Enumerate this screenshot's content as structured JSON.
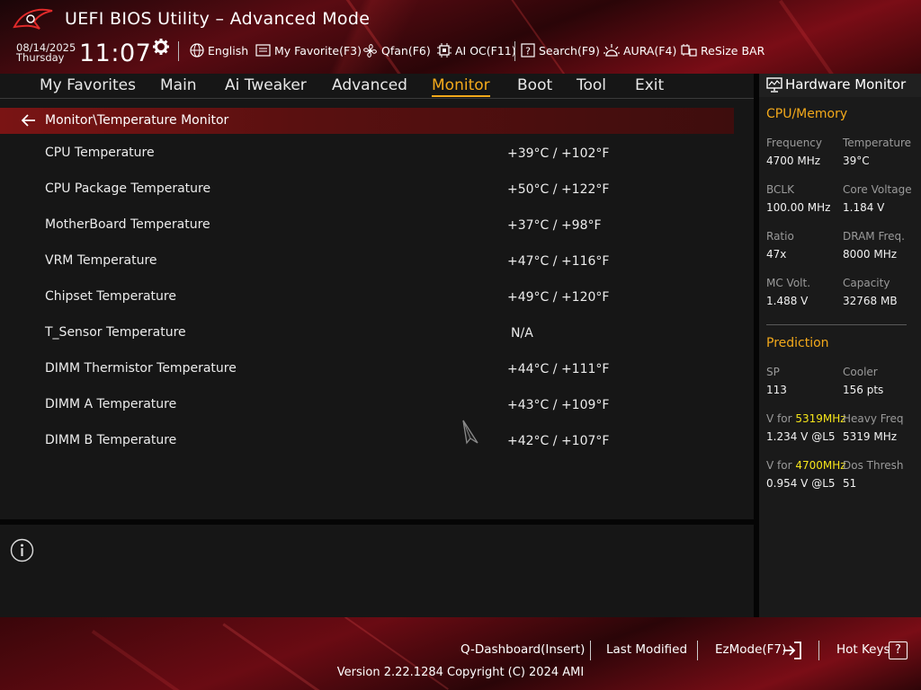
{
  "header": {
    "title": "UEFI BIOS Utility – Advanced Mode",
    "date": "08/14/2025",
    "day": "Thursday",
    "time": "11:07",
    "tools": [
      {
        "label": "English",
        "icon": "globe-icon"
      },
      {
        "label": "My Favorite(F3)",
        "icon": "favorite-icon"
      },
      {
        "label": "Qfan(F6)",
        "icon": "fan-icon"
      },
      {
        "label": "AI OC(F11)",
        "icon": "ai-chip-icon"
      },
      {
        "label": "Search(F9)",
        "icon": "search-icon"
      },
      {
        "label": "AURA(F4)",
        "icon": "aura-icon"
      },
      {
        "label": "ReSize BAR",
        "icon": "resize-bar-icon"
      }
    ]
  },
  "nav": {
    "tabs": [
      "My Favorites",
      "Main",
      "Ai Tweaker",
      "Advanced",
      "Monitor",
      "Boot",
      "Tool",
      "Exit"
    ],
    "active": "Monitor"
  },
  "breadcrumb": "Monitor\\Temperature Monitor",
  "temperatures": [
    {
      "label": "CPU Temperature",
      "value": "+39°C / +102°F"
    },
    {
      "label": "CPU Package Temperature",
      "value": "+50°C / +122°F"
    },
    {
      "label": "MotherBoard Temperature",
      "value": "+37°C / +98°F"
    },
    {
      "label": "VRM Temperature",
      "value": "+47°C / +116°F"
    },
    {
      "label": "Chipset Temperature",
      "value": "+49°C / +120°F"
    },
    {
      "label": "T_Sensor Temperature",
      "value": " N/A"
    },
    {
      "label": "DIMM Thermistor Temperature",
      "value": "+44°C / +111°F"
    },
    {
      "label": "DIMM A Temperature",
      "value": "+43°C / +109°F"
    },
    {
      "label": "DIMM B Temperature",
      "value": "+42°C / +107°F"
    }
  ],
  "hardware_monitor": {
    "title": "Hardware Monitor",
    "cpu_memory": {
      "heading": "CPU/Memory",
      "items": [
        {
          "key": "Frequency",
          "value": "4700 MHz"
        },
        {
          "key": "Temperature",
          "value": "39°C"
        },
        {
          "key": "BCLK",
          "value": "100.00 MHz"
        },
        {
          "key": "Core Voltage",
          "value": "1.184 V"
        },
        {
          "key": "Ratio",
          "value": "47x"
        },
        {
          "key": "DRAM Freq.",
          "value": "8000 MHz"
        },
        {
          "key": "MC Volt.",
          "value": "1.488 V"
        },
        {
          "key": "Capacity",
          "value": "32768 MB"
        }
      ]
    },
    "prediction": {
      "heading": "Prediction",
      "sp_key": "SP",
      "sp_value": "113",
      "cooler_key": "Cooler",
      "cooler_value": "156 pts",
      "v1_prefix": "V for ",
      "v1_freq": "5319MHz",
      "v1_value": "1.234 V @L5",
      "heavy_key": "Heavy Freq",
      "heavy_value": "5319 MHz",
      "v2_prefix": "V for ",
      "v2_freq": "4700MHz",
      "v2_value": "0.954 V @L5",
      "dos_key": "Dos Thresh",
      "dos_value": "51"
    }
  },
  "footer": {
    "qdashboard": "Q-Dashboard(Insert)",
    "last_modified": "Last Modified",
    "ezmode": "EzMode(F7)",
    "hotkeys": "Hot Keys",
    "hotkeys_glyph": "?",
    "version": "Version 2.22.1284 Copyright (C) 2024 AMI"
  },
  "colors": {
    "accent": "#f3a91b",
    "highlight_yellow": "#f6e51a",
    "brand_red": "#7a0d16"
  }
}
